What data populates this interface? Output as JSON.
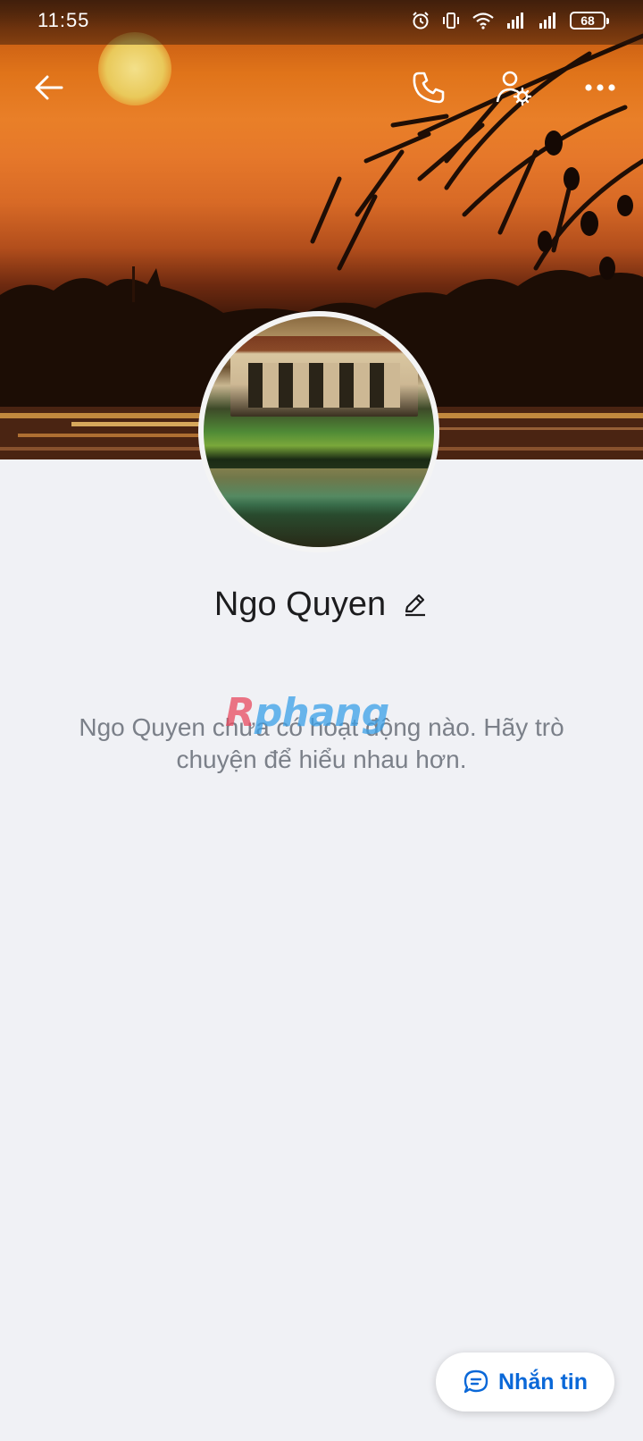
{
  "status_bar": {
    "time": "11:55",
    "battery": "68",
    "icons": [
      "alarm-icon",
      "vibrate-icon",
      "wifi-icon",
      "signal-icon",
      "signal-icon",
      "battery-icon"
    ]
  },
  "top_bar": {
    "icons": [
      "back-arrow-icon",
      "phone-icon",
      "user-settings-icon",
      "more-dots-icon"
    ]
  },
  "profile": {
    "name": "Ngo Quyen",
    "edit_icon": "pencil-icon",
    "empty_message": "Ngo Quyen chưa có hoạt động nào. Hãy trò chuyện để hiểu nhau hơn."
  },
  "watermark": {
    "first": "R",
    "rest": "phang"
  },
  "message_button": {
    "label": "Nhắn tin",
    "icon": "chat-bubble-icon"
  },
  "colors": {
    "accent": "#0a68d8",
    "background": "#f0f1f5",
    "muted_text": "#7b8089"
  }
}
